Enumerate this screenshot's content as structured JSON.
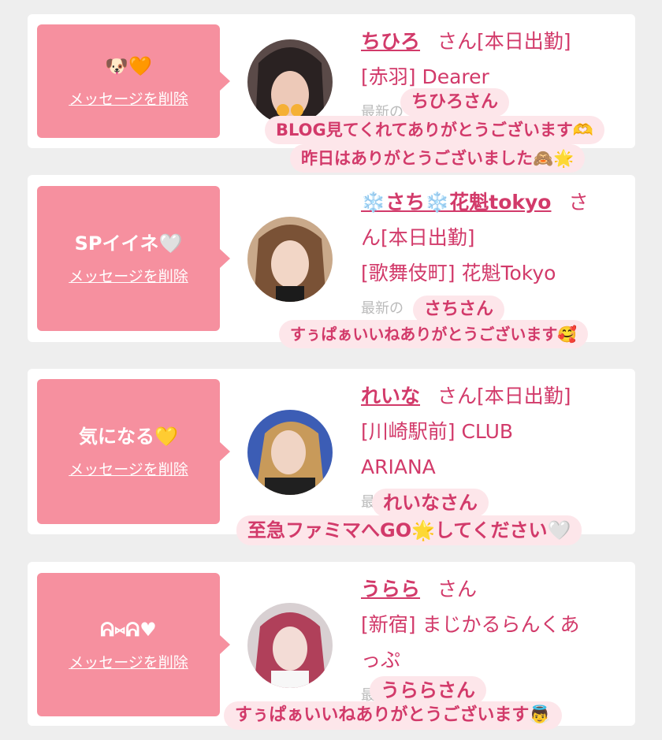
{
  "cards": [
    {
      "message": "🐶🧡",
      "delete_label": "メッセージを削除",
      "name": "ちひろ",
      "honorific": "さん",
      "status": "[本日出勤]",
      "shop": "[赤羽] Dearer",
      "latest": "最新の"
    },
    {
      "message": "SPイイネ🤍",
      "delete_label": "メッセージを削除",
      "name": "❄️さち❄️花魁tokyo",
      "honorific": "さ",
      "status": "ん[本日出勤]",
      "shop": "[歌舞伎町] 花魁Tokyo",
      "latest": "最新の"
    },
    {
      "message": "気になる💛",
      "delete_label": "メッセージを削除",
      "name": "れいな",
      "honorific": "さん",
      "status": "[本日出勤]",
      "shop": "[川崎駅前] CLUB",
      "shop2": "ARIANA",
      "latest": "最"
    },
    {
      "message": "ᕱ⑅ᕱ♥",
      "delete_label": "メッセージを削除",
      "name": "うらら",
      "honorific": "さん",
      "shop": "[新宿] まじかるらんくあ",
      "shop2": "っぷ",
      "latest": "最"
    }
  ],
  "overlays": {
    "c1_head": "ちひろさん",
    "c1_l1": "BLOG見てくれてありがとうございます🫶",
    "c1_l2": "昨日はありがとうございました🙈🌟",
    "c2_head": "さちさん",
    "c2_l1": "すぅぱぁいいねありがとうございます🥰",
    "c3_head": "れいなさん",
    "c3_l1": "至急ファミマへGO🌟してください🤍",
    "c4_head": "うららさん",
    "c4_l1": "すぅぱぁいいねありがとうございます👼"
  },
  "colors": {
    "accent": "#d23a6a",
    "bubble": "#f6909f",
    "overlay_bg": "#fde6ea"
  }
}
